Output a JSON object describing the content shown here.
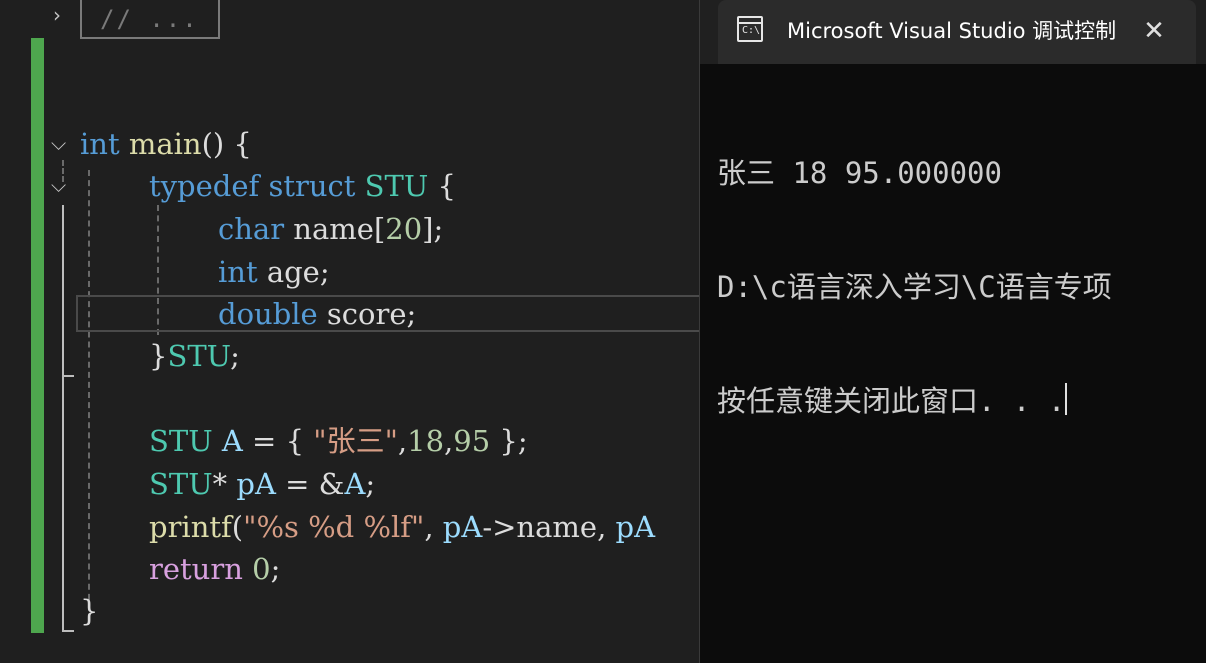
{
  "editor": {
    "collapsed_fold": {
      "text": "// ..."
    },
    "code": {
      "l1": {
        "int": "int",
        "main": "main",
        "rest": "() {"
      },
      "l2": {
        "typedef": "typedef",
        "struct": "struct",
        "STU": "STU",
        "brace": "{"
      },
      "l3": {
        "char": "char",
        "name": "name",
        "b1": "[",
        "n20": "20",
        "b2": "];"
      },
      "l4": {
        "int": "int",
        "age": "age",
        "semi": ";"
      },
      "l5": {
        "double": "double",
        "score": "score",
        "semi": ";"
      },
      "l6": {
        "brace": "}",
        "STU": "STU",
        "semi": ";"
      },
      "l7": {
        "STU": "STU",
        "A": "A",
        "eq": " = { ",
        "str": "\"张三\"",
        "c1": ",",
        "n18": "18",
        "c2": ",",
        "n95": "95",
        "end": " };"
      },
      "l8": {
        "STU": "STU",
        "star": "* ",
        "pA": "pA",
        "eq": " = &",
        "A": "A",
        "semi": ";"
      },
      "l9": {
        "printf": "printf",
        "paren": "(",
        "fmt": "\"%s %d %lf\"",
        "c1": ", ",
        "pA1": "pA",
        "arrow": "->",
        "name": "name",
        "c2": ", ",
        "pA2": "pA"
      },
      "l10": {
        "return": "return",
        "zero": "0",
        "semi": ";"
      },
      "l11": {
        "brace": "}"
      }
    }
  },
  "console": {
    "tab_title": "Microsoft Visual Studio 调试控制台",
    "icon_text": "C:\\",
    "close_glyph": "✕",
    "output": [
      "张三 18 95.000000",
      "D:\\c语言深入学习\\C语言专项",
      "按任意键关闭此窗口. . ."
    ]
  }
}
